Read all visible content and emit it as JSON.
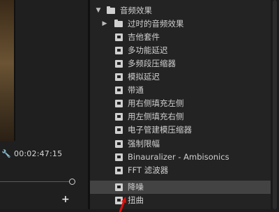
{
  "monitor": {
    "timecode": "00:02:47:15",
    "add_label": "+"
  },
  "effects_panel": {
    "category": "音频效果",
    "subfolder": "过时的音频效果",
    "items": [
      {
        "label": "吉他套件"
      },
      {
        "label": "多功能延迟"
      },
      {
        "label": "多频段压缩器"
      },
      {
        "label": "模拟延迟"
      },
      {
        "label": "带通"
      },
      {
        "label": "用右侧填充左侧"
      },
      {
        "label": "用左侧填充右侧"
      },
      {
        "label": "电子管建模压缩器"
      },
      {
        "label": "强制限幅"
      },
      {
        "label": "Binauralizer - Ambisonics"
      },
      {
        "label": "FFT 滤波器"
      },
      {
        "label": "降噪",
        "selected": true
      },
      {
        "label": "扭曲"
      }
    ]
  },
  "colors": {
    "selection": "#434343",
    "annotation_arrow": "#e01010"
  }
}
